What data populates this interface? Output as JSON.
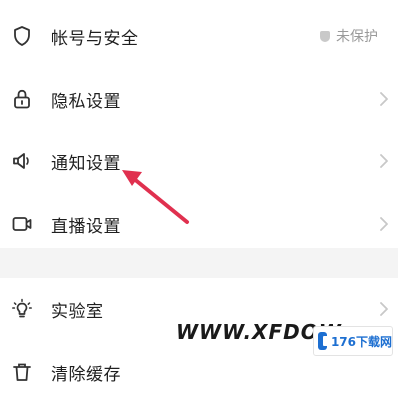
{
  "settings": {
    "items": [
      {
        "label": "帐号与安全",
        "value": "未保护",
        "icon": "shield-icon"
      },
      {
        "label": "隐私设置",
        "icon": "lock-icon"
      },
      {
        "label": "通知设置",
        "icon": "speaker-icon"
      },
      {
        "label": "直播设置",
        "icon": "video-camera-icon"
      },
      {
        "label": "实验室",
        "icon": "lightbulb-icon"
      },
      {
        "label": "清除缓存",
        "icon": "trash-icon"
      }
    ]
  },
  "watermark": {
    "text": "WWW.XFDOW",
    "badge": "176下载网"
  },
  "colors": {
    "arrow": "#e0304f",
    "chevron": "#c8c8c8",
    "section_gap": "#f4f4f4"
  }
}
